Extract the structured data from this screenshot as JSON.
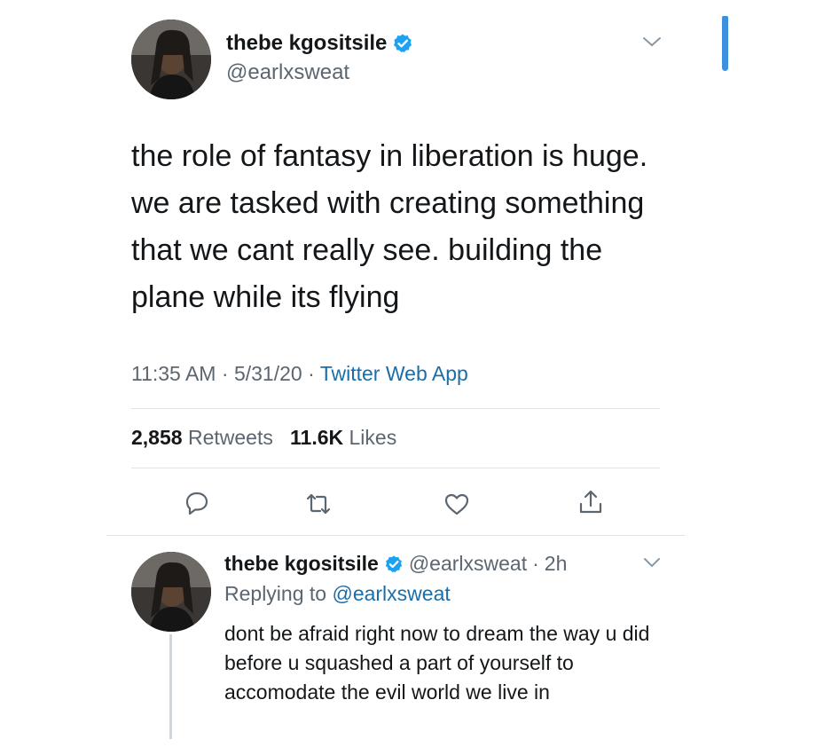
{
  "tweet": {
    "display_name": "thebe kgositsile",
    "handle": "@earlxsweat",
    "text": "the role of fantasy in liberation is huge. we are tasked with creating something that we cant really see. building the plane while its flying",
    "time": "11:35 AM",
    "date": "5/31/20",
    "separator": "·",
    "source": "Twitter Web App",
    "retweets_count": "2,858",
    "retweets_label": "Retweets",
    "likes_count": "11.6K",
    "likes_label": "Likes"
  },
  "actions": {
    "icons": [
      "reply-icon",
      "retweet-icon",
      "like-icon",
      "share-icon"
    ]
  },
  "reply": {
    "display_name": "thebe kgositsile",
    "handle": "@earlxsweat",
    "separator": "·",
    "age": "2h",
    "replying_label": "Replying to",
    "replying_to": "@earlxsweat",
    "text": "dont be afraid right now to dream the way u did before u squashed a part of yourself to accomodate the evil world we live in"
  },
  "colors": {
    "verified": "#1da1f2",
    "link": "#1b6ea8",
    "secondary_text": "#5b6670",
    "divider": "#e1e5e8",
    "scroll_indicator": "#3d8fe0"
  }
}
